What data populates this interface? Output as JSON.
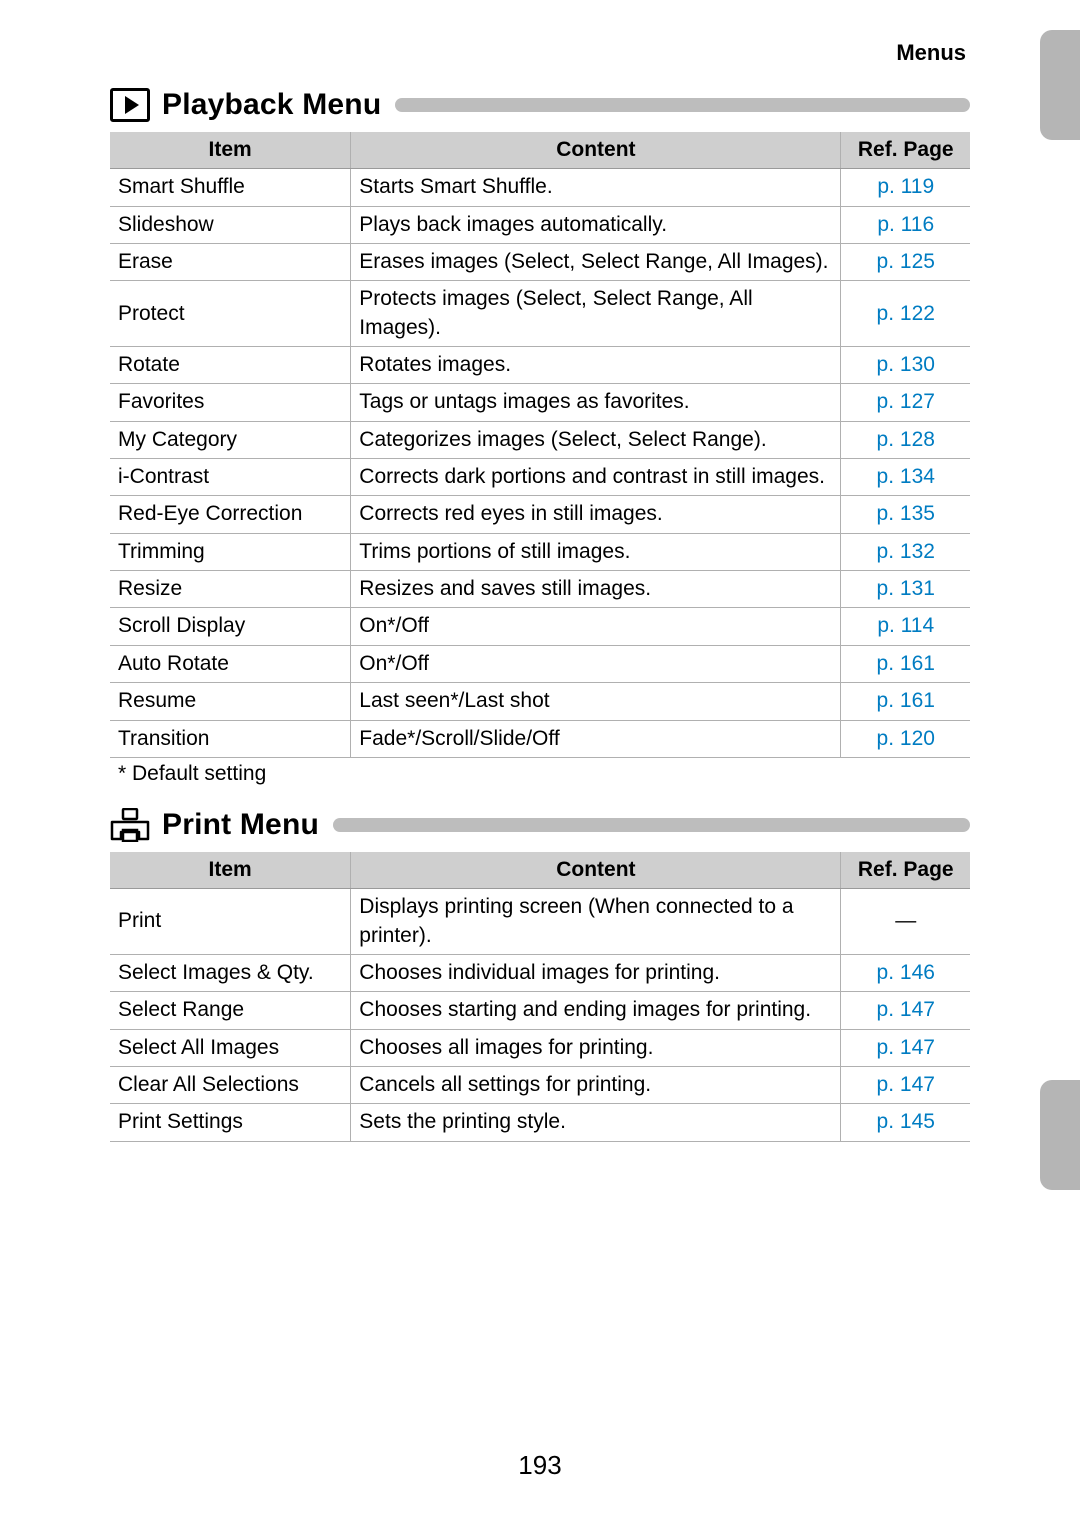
{
  "top_label": "Menus",
  "page_number": "193",
  "footnote": "*  Default setting",
  "columns": {
    "item": "Item",
    "content": "Content",
    "ref": "Ref. Page"
  },
  "sections": {
    "playback": {
      "title": "Playback Menu",
      "rows": [
        {
          "item": "Smart Shuffle",
          "content": "Starts Smart Shuffle.",
          "ref": "p. 119"
        },
        {
          "item": "Slideshow",
          "content": "Plays back images automatically.",
          "ref": "p. 116"
        },
        {
          "item": "Erase",
          "content": "Erases images (Select, Select Range, All Images).",
          "ref": "p. 125"
        },
        {
          "item": "Protect",
          "content": "Protects images (Select, Select Range, All Images).",
          "ref": "p. 122"
        },
        {
          "item": "Rotate",
          "content": "Rotates images.",
          "ref": "p. 130"
        },
        {
          "item": "Favorites",
          "content": "Tags or untags images as favorites.",
          "ref": "p. 127"
        },
        {
          "item": "My Category",
          "content": "Categorizes images (Select, Select Range).",
          "ref": "p. 128"
        },
        {
          "item": "i-Contrast",
          "content": "Corrects dark portions and contrast in still images.",
          "ref": "p. 134"
        },
        {
          "item": "Red-Eye Correction",
          "content": "Corrects red eyes in still images.",
          "ref": "p. 135"
        },
        {
          "item": "Trimming",
          "content": "Trims portions of still images.",
          "ref": "p. 132"
        },
        {
          "item": "Resize",
          "content": "Resizes and saves still images.",
          "ref": "p. 131"
        },
        {
          "item": "Scroll Display",
          "content": "On*/Off",
          "ref": "p. 114"
        },
        {
          "item": "Auto Rotate",
          "content": "On*/Off",
          "ref": "p. 161"
        },
        {
          "item": "Resume",
          "content": "Last seen*/Last shot",
          "ref": "p. 161"
        },
        {
          "item": "Transition",
          "content": "Fade*/Scroll/Slide/Off",
          "ref": "p. 120"
        }
      ]
    },
    "print": {
      "title": "Print Menu",
      "rows": [
        {
          "item": "Print",
          "content": "Displays printing screen (When connected to a printer).",
          "ref": "—"
        },
        {
          "item": "Select Images & Qty.",
          "content": "Chooses individual images for printing.",
          "ref": "p. 146"
        },
        {
          "item": "Select Range",
          "content": "Chooses starting and ending images for printing.",
          "ref": "p. 147"
        },
        {
          "item": "Select All Images",
          "content": "Chooses all images for printing.",
          "ref": "p. 147"
        },
        {
          "item": "Clear All Selections",
          "content": "Cancels all settings for printing.",
          "ref": "p. 147"
        },
        {
          "item": "Print Settings",
          "content": "Sets the printing style.",
          "ref": "p. 145"
        }
      ]
    }
  }
}
